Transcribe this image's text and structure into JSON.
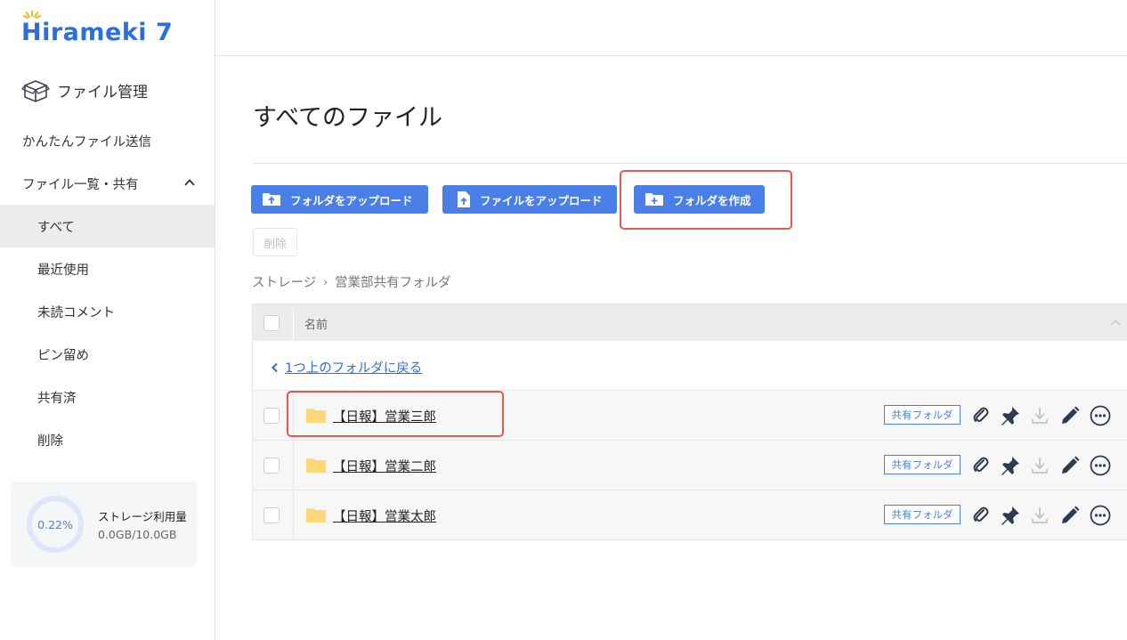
{
  "brand": {
    "name": "Hirameki 7"
  },
  "sidebar": {
    "main_label": "ファイル管理",
    "items": [
      {
        "label": "かんたんファイル送信"
      },
      {
        "label": "ファイル一覧・共有"
      },
      {
        "label": "すべて"
      },
      {
        "label": "最近使用"
      },
      {
        "label": "未読コメント"
      },
      {
        "label": "ピン留め"
      },
      {
        "label": "共有済"
      },
      {
        "label": "削除"
      }
    ],
    "storage": {
      "percent_label": "0.22%",
      "percent": 0.22,
      "title": "ストレージ利用量",
      "amount": "0.0GB/10.0GB"
    }
  },
  "main": {
    "title": "すべてのファイル",
    "buttons": {
      "upload_folder": "フォルダをアップロード",
      "upload_file": "ファイルをアップロード",
      "create_folder": "フォルダを作成",
      "delete": "削除"
    },
    "breadcrumb": {
      "root": "ストレージ",
      "current": "営業部共有フォルダ"
    },
    "table": {
      "header_name": "名前",
      "back_link": "1つ上のフォルダに戻る",
      "rows": [
        {
          "name": "【日報】営業三郎",
          "badge": "共有フォルダ"
        },
        {
          "name": "【日報】営業二郎",
          "badge": "共有フォルダ"
        },
        {
          "name": "【日報】営業太郎",
          "badge": "共有フォルダ"
        }
      ]
    }
  },
  "colors": {
    "accent": "#4a7fe8",
    "brand": "#2a6fdb",
    "highlight": "#e8584f",
    "folder": "#fbd776"
  }
}
